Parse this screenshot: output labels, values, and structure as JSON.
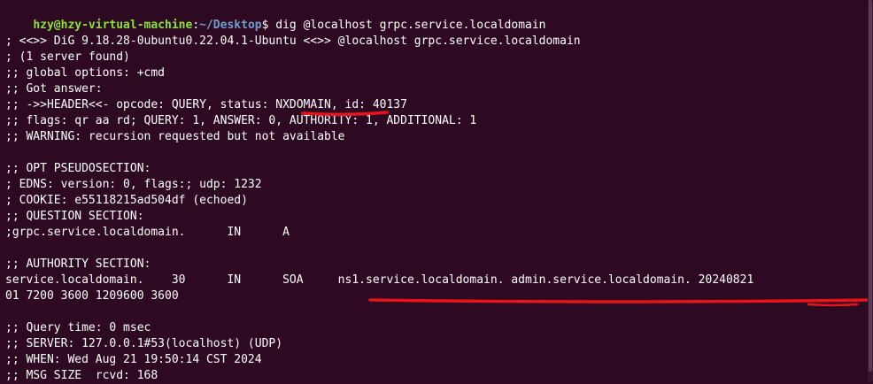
{
  "prompt": {
    "user_host": "hzy@hzy-virtual-machine",
    "separator": ":",
    "path": "~/Desktop",
    "symbol": "$",
    "command": " dig @localhost grpc.service.localdomain"
  },
  "output": {
    "line_01": "; <<>> DiG 9.18.28-0ubuntu0.22.04.1-Ubuntu <<>> @localhost grpc.service.localdomain",
    "line_02": "; (1 server found)",
    "line_03": ";; global options: +cmd",
    "line_04": ";; Got answer:",
    "line_05": ";; ->>HEADER<<- opcode: QUERY, status: NXDOMAIN, id: 40137",
    "line_06": ";; flags: qr aa rd; QUERY: 1, ANSWER: 0, AUTHORITY: 1, ADDITIONAL: 1",
    "line_07": ";; WARNING: recursion requested but not available",
    "line_08": ";; OPT PSEUDOSECTION:",
    "line_09": "; EDNS: version: 0, flags:; udp: 1232",
    "line_10": "; COOKIE: e55118215ad504df (echoed)",
    "line_11": ";; QUESTION SECTION:",
    "line_12": ";grpc.service.localdomain.      IN      A",
    "line_13": ";; AUTHORITY SECTION:",
    "line_14": "service.localdomain.    30      IN      SOA     ns1.service.localdomain. admin.service.localdomain. 20240821",
    "line_15": "01 7200 3600 1209600 3600",
    "line_16": ";; Query time: 0 msec",
    "line_17": ";; SERVER: 127.0.0.1#53(localhost) (UDP)",
    "line_18": ";; WHEN: Wed Aug 21 19:50:14 CST 2024",
    "line_19": ";; MSG SIZE  rcvd: 168"
  },
  "colors": {
    "background": "#2d0922",
    "prompt_user": "#8ae234",
    "prompt_path": "#729fcf",
    "text": "#ffffff",
    "annotation": "#e8131b"
  }
}
